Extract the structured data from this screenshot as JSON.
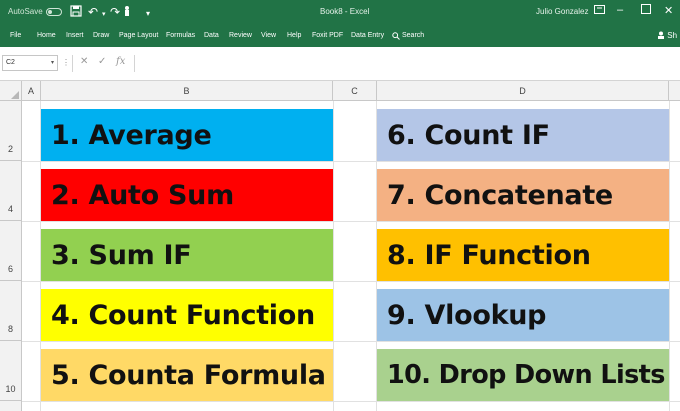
{
  "titlebar": {
    "autosave_label": "AutoSave",
    "doc_title": "Book8 - Excel",
    "user_name": "Julio Gonzalez",
    "icons": [
      "save-icon",
      "undo-icon",
      "redo-icon",
      "touch-mode-icon",
      "customize-qat-icon"
    ],
    "window_controls": [
      "ribbon-display-icon",
      "minimize-icon",
      "maximize-icon",
      "close-icon"
    ]
  },
  "ribbon": {
    "tabs": [
      "File",
      "Home",
      "Insert",
      "Draw",
      "Page Layout",
      "Formulas",
      "Data",
      "Review",
      "View",
      "Help",
      "Foxit PDF",
      "Data Entry",
      "Search"
    ],
    "share_label": "Sh"
  },
  "formula_bar": {
    "name_box": "C2",
    "formula": ""
  },
  "grid": {
    "columns": [
      "A",
      "B",
      "C",
      "D"
    ],
    "rows": [
      "2",
      "4",
      "6",
      "8",
      "10"
    ],
    "cells_b": [
      {
        "text": "1.  Average",
        "color": "#00b0f0"
      },
      {
        "text": "2.  Auto Sum",
        "color": "#ff0000"
      },
      {
        "text": "3.  Sum IF",
        "color": "#92d050"
      },
      {
        "text": "4.  Count Function",
        "color": "#ffff00"
      },
      {
        "text": "5.  Counta  Formula",
        "color": "#ffd966"
      }
    ],
    "cells_d": [
      {
        "text": "6.  Count IF",
        "color": "#b4c6e7"
      },
      {
        "text": "7.  Concatenate",
        "color": "#f4b183"
      },
      {
        "text": "8.  IF Function",
        "color": "#ffc000"
      },
      {
        "text": "9.  Vlookup",
        "color": "#9dc3e6"
      },
      {
        "text": "10.  Drop Down Lists",
        "color": "#a9d18e"
      }
    ]
  },
  "colors": {
    "excel_green": "#217346",
    "header_gray": "#f2f2f2"
  }
}
